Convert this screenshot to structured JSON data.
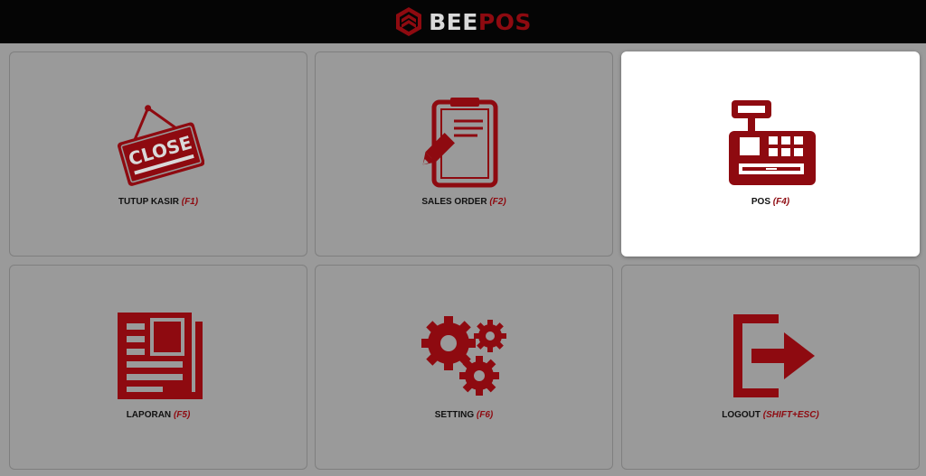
{
  "header": {
    "brand_bee": "BEE",
    "brand_pos": "POS",
    "logo_icon": "hexagon-chevron-icon"
  },
  "colors": {
    "accent": "#8e0a10",
    "header_bg": "#050505",
    "tile_bg": "#9a9a9a",
    "tile_active_bg": "#ffffff"
  },
  "menu": {
    "tiles": [
      {
        "label": "TUTUP KASIR",
        "key": "(F1)",
        "icon": "close-sign-icon",
        "active": false
      },
      {
        "label": "SALES ORDER",
        "key": "(F2)",
        "icon": "clipboard-pen-icon",
        "active": false
      },
      {
        "label": "POS",
        "key": "(F4)",
        "icon": "cash-register-icon",
        "active": true
      },
      {
        "label": "LAPORAN",
        "key": "(F5)",
        "icon": "report-document-icon",
        "active": false
      },
      {
        "label": "SETTING",
        "key": "(F6)",
        "icon": "gears-icon",
        "active": false
      },
      {
        "label": "LOGOUT",
        "key": "(SHIFT+ESC)",
        "icon": "logout-icon",
        "active": false
      }
    ],
    "close_sign_text": "CLOSE"
  }
}
